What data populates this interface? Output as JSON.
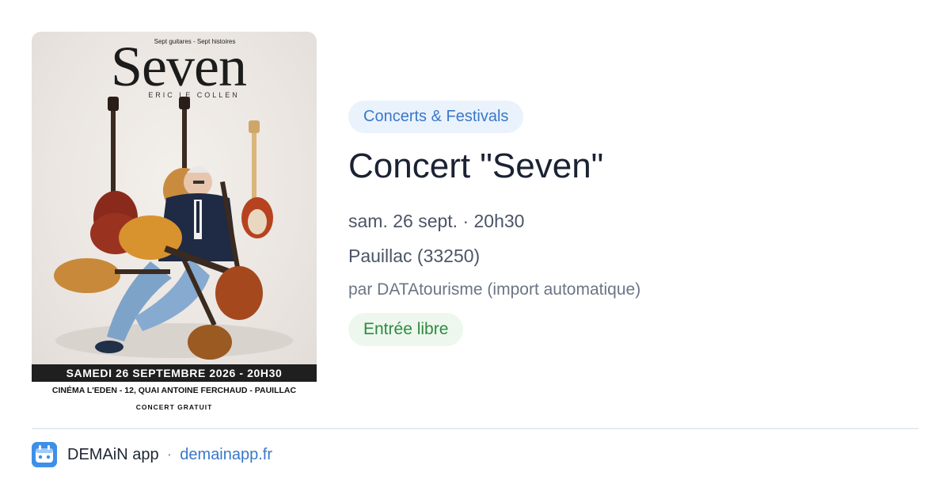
{
  "poster": {
    "tagline": "Sept guitares - Sept histoires",
    "title": "Seven",
    "artist": "ERIC LE COLLEN",
    "date_bar": "SAMEDI 26 SEPTEMBRE 2026 - 20H30",
    "venue": "CINÉMA L'EDEN - 12, QUAI ANTOINE FERCHAUD - PAUILLAC",
    "free_label": "CONCERT GRATUIT"
  },
  "event": {
    "category": "Concerts & Festivals",
    "title": "Concert \"Seven\"",
    "datetime": "sam. 26 sept. · 20h30",
    "location": "Pauillac (33250)",
    "source": "par DATAtourisme (import automatique)",
    "price": "Entrée libre"
  },
  "footer": {
    "app_name": "DEMAiN app",
    "separator": "·",
    "link": "demainapp.fr"
  },
  "colors": {
    "accent": "#3a78c9",
    "category_bg": "#eaf2fc",
    "price_text": "#2f8a3f",
    "price_bg": "#edf7ee",
    "app_icon": "#3f8fe8"
  }
}
